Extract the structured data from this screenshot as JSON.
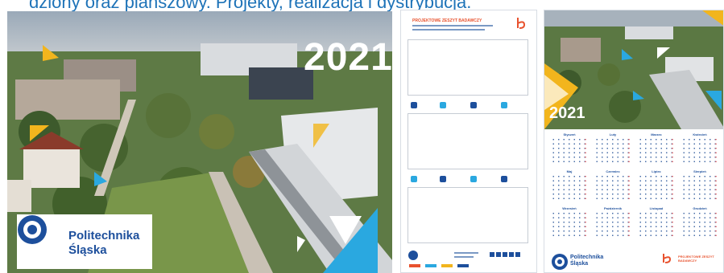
{
  "heading": "dziony oraz planszowy. Projekty, realizacja i dystrybucja.",
  "wall_calendar": {
    "year": "2021",
    "logo_line1": "Politechnika",
    "logo_line2": "Śląska"
  },
  "planner": {
    "title": "PROJEKTOWE ZESZYT BADAWCZY"
  },
  "poster_calendar": {
    "year": "2021",
    "months": [
      "Styczeń",
      "Luty",
      "Marzec",
      "Kwiecień",
      "Maj",
      "Czerwiec",
      "Lipiec",
      "Sierpień",
      "Wrzesień",
      "Październik",
      "Listopad",
      "Grudzień"
    ],
    "logo_line1": "Politechnika",
    "logo_line2": "Śląska",
    "footer_right": "PROJEKTOWE ZESZYT BADAWCZY"
  },
  "colors": {
    "brand_blue": "#1d4f9c",
    "accent_yellow": "#f2b51d",
    "accent_cyan": "#2aa8e0",
    "accent_red": "#e8522e"
  }
}
